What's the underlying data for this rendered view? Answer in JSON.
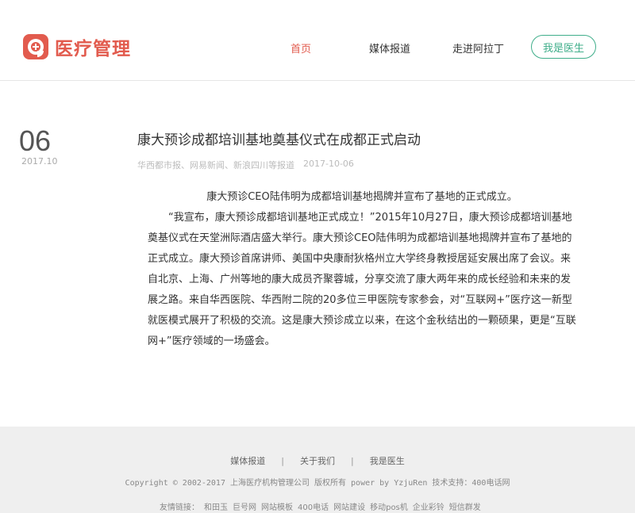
{
  "brand": {
    "name": "医疗管理",
    "color": "#e25b4e"
  },
  "nav": {
    "home": "首页",
    "media": "媒体报道",
    "about": "走进阿拉丁",
    "doctor": "我是医生"
  },
  "article": {
    "day": "06",
    "year_month": "2017.10",
    "title": "康大预诊成都培训基地奠基仪式在成都正式启动",
    "source": "华西都市报、网易新闻、新浪四川等报道",
    "date": "2017-10-06",
    "paragraphs": [
      "康大预诊CEO陆伟明为成都培训基地揭牌并宣布了基地的正式成立。",
      "“我宣布，康大预诊成都培训基地正式成立！”2015年10月27日，康大预诊成都培训基地奠基仪式在天堂洲际酒店盛大举行。康大预诊CEO陆伟明为成都培训基地揭牌并宣布了基地的正式成立。康大预诊首席讲师、美国中央康耐狄格州立大学终身教授居延安展出席了会议。来自北京、上海、广州等地的康大成员齐聚蓉城，分享交流了康大两年来的成长经验和未来的发展之路。来自华西医院、华西附二院的20多位三甲医院专家参会，对“互联网+”医疗这一新型就医模式展开了积极的交流。这是康大预诊成立以来，在这个金秋结出的一颗硕果，更是“互联网+”医疗领域的一场盛会。"
    ]
  },
  "footer": {
    "links": [
      "媒体报道",
      "关于我们",
      "我是医生"
    ],
    "separator": "|",
    "copyright": "Copyright © 2002-2017 上海医疗机构管理公司 版权所有 power by YzjuRen 技术支持：400电话网",
    "friends_label": "友情链接：",
    "friends": [
      "和田玉",
      "巨号网",
      "网站模板",
      "400电话",
      "网站建设",
      "移动pos机",
      "企业彩铃",
      "短信群发"
    ]
  }
}
